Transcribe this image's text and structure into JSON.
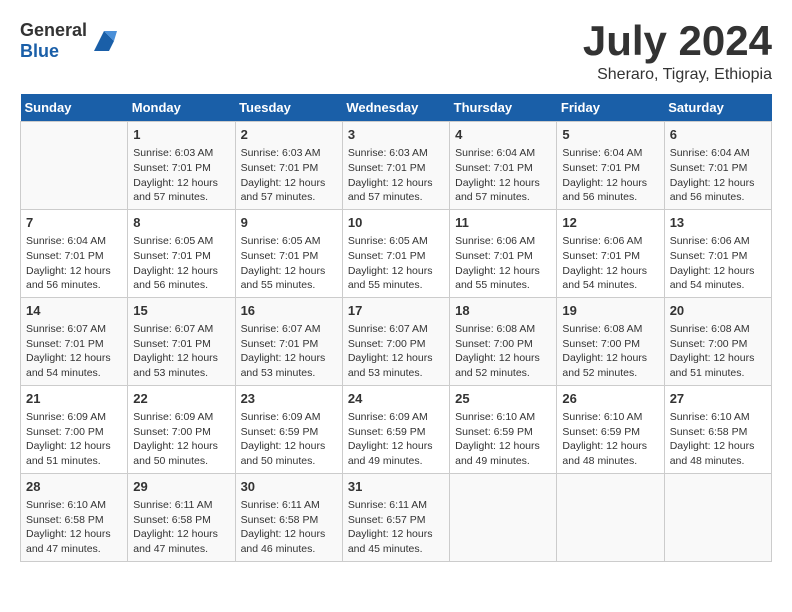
{
  "header": {
    "logo_general": "General",
    "logo_blue": "Blue",
    "title": "July 2024",
    "subtitle": "Sheraro, Tigray, Ethiopia"
  },
  "calendar": {
    "days_of_week": [
      "Sunday",
      "Monday",
      "Tuesday",
      "Wednesday",
      "Thursday",
      "Friday",
      "Saturday"
    ],
    "weeks": [
      [
        {
          "day": "",
          "info": ""
        },
        {
          "day": "1",
          "info": "Sunrise: 6:03 AM\nSunset: 7:01 PM\nDaylight: 12 hours\nand 57 minutes."
        },
        {
          "day": "2",
          "info": "Sunrise: 6:03 AM\nSunset: 7:01 PM\nDaylight: 12 hours\nand 57 minutes."
        },
        {
          "day": "3",
          "info": "Sunrise: 6:03 AM\nSunset: 7:01 PM\nDaylight: 12 hours\nand 57 minutes."
        },
        {
          "day": "4",
          "info": "Sunrise: 6:04 AM\nSunset: 7:01 PM\nDaylight: 12 hours\nand 57 minutes."
        },
        {
          "day": "5",
          "info": "Sunrise: 6:04 AM\nSunset: 7:01 PM\nDaylight: 12 hours\nand 56 minutes."
        },
        {
          "day": "6",
          "info": "Sunrise: 6:04 AM\nSunset: 7:01 PM\nDaylight: 12 hours\nand 56 minutes."
        }
      ],
      [
        {
          "day": "7",
          "info": "Sunrise: 6:04 AM\nSunset: 7:01 PM\nDaylight: 12 hours\nand 56 minutes."
        },
        {
          "day": "8",
          "info": "Sunrise: 6:05 AM\nSunset: 7:01 PM\nDaylight: 12 hours\nand 56 minutes."
        },
        {
          "day": "9",
          "info": "Sunrise: 6:05 AM\nSunset: 7:01 PM\nDaylight: 12 hours\nand 55 minutes."
        },
        {
          "day": "10",
          "info": "Sunrise: 6:05 AM\nSunset: 7:01 PM\nDaylight: 12 hours\nand 55 minutes."
        },
        {
          "day": "11",
          "info": "Sunrise: 6:06 AM\nSunset: 7:01 PM\nDaylight: 12 hours\nand 55 minutes."
        },
        {
          "day": "12",
          "info": "Sunrise: 6:06 AM\nSunset: 7:01 PM\nDaylight: 12 hours\nand 54 minutes."
        },
        {
          "day": "13",
          "info": "Sunrise: 6:06 AM\nSunset: 7:01 PM\nDaylight: 12 hours\nand 54 minutes."
        }
      ],
      [
        {
          "day": "14",
          "info": "Sunrise: 6:07 AM\nSunset: 7:01 PM\nDaylight: 12 hours\nand 54 minutes."
        },
        {
          "day": "15",
          "info": "Sunrise: 6:07 AM\nSunset: 7:01 PM\nDaylight: 12 hours\nand 53 minutes."
        },
        {
          "day": "16",
          "info": "Sunrise: 6:07 AM\nSunset: 7:01 PM\nDaylight: 12 hours\nand 53 minutes."
        },
        {
          "day": "17",
          "info": "Sunrise: 6:07 AM\nSunset: 7:00 PM\nDaylight: 12 hours\nand 53 minutes."
        },
        {
          "day": "18",
          "info": "Sunrise: 6:08 AM\nSunset: 7:00 PM\nDaylight: 12 hours\nand 52 minutes."
        },
        {
          "day": "19",
          "info": "Sunrise: 6:08 AM\nSunset: 7:00 PM\nDaylight: 12 hours\nand 52 minutes."
        },
        {
          "day": "20",
          "info": "Sunrise: 6:08 AM\nSunset: 7:00 PM\nDaylight: 12 hours\nand 51 minutes."
        }
      ],
      [
        {
          "day": "21",
          "info": "Sunrise: 6:09 AM\nSunset: 7:00 PM\nDaylight: 12 hours\nand 51 minutes."
        },
        {
          "day": "22",
          "info": "Sunrise: 6:09 AM\nSunset: 7:00 PM\nDaylight: 12 hours\nand 50 minutes."
        },
        {
          "day": "23",
          "info": "Sunrise: 6:09 AM\nSunset: 6:59 PM\nDaylight: 12 hours\nand 50 minutes."
        },
        {
          "day": "24",
          "info": "Sunrise: 6:09 AM\nSunset: 6:59 PM\nDaylight: 12 hours\nand 49 minutes."
        },
        {
          "day": "25",
          "info": "Sunrise: 6:10 AM\nSunset: 6:59 PM\nDaylight: 12 hours\nand 49 minutes."
        },
        {
          "day": "26",
          "info": "Sunrise: 6:10 AM\nSunset: 6:59 PM\nDaylight: 12 hours\nand 48 minutes."
        },
        {
          "day": "27",
          "info": "Sunrise: 6:10 AM\nSunset: 6:58 PM\nDaylight: 12 hours\nand 48 minutes."
        }
      ],
      [
        {
          "day": "28",
          "info": "Sunrise: 6:10 AM\nSunset: 6:58 PM\nDaylight: 12 hours\nand 47 minutes."
        },
        {
          "day": "29",
          "info": "Sunrise: 6:11 AM\nSunset: 6:58 PM\nDaylight: 12 hours\nand 47 minutes."
        },
        {
          "day": "30",
          "info": "Sunrise: 6:11 AM\nSunset: 6:58 PM\nDaylight: 12 hours\nand 46 minutes."
        },
        {
          "day": "31",
          "info": "Sunrise: 6:11 AM\nSunset: 6:57 PM\nDaylight: 12 hours\nand 45 minutes."
        },
        {
          "day": "",
          "info": ""
        },
        {
          "day": "",
          "info": ""
        },
        {
          "day": "",
          "info": ""
        }
      ]
    ]
  }
}
